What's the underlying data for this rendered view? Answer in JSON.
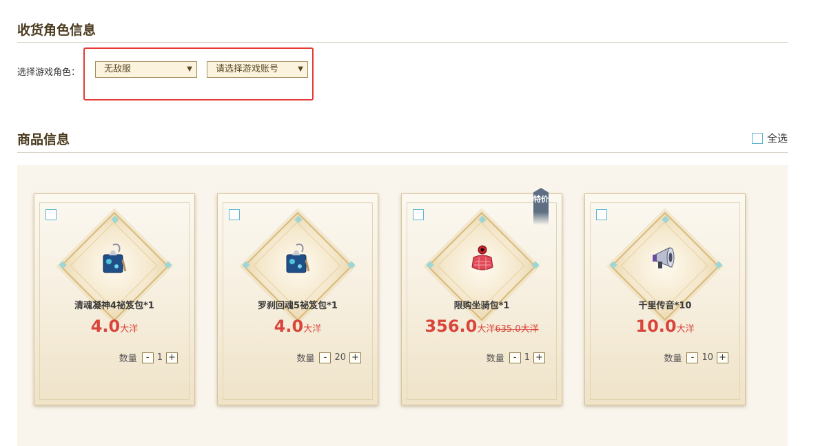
{
  "receiver": {
    "title": "收货角色信息",
    "label": "选择游戏角色：",
    "server_select": "无敌服",
    "account_select": "请选择游戏账号"
  },
  "goods": {
    "title": "商品信息",
    "select_all": "全选",
    "qty_label": "数量",
    "minus": "-",
    "plus": "+",
    "items": [
      {
        "name": "清魂凝神4祕笈包*1",
        "price": "4.0",
        "unit": "大洋",
        "old_price": "",
        "qty": "1",
        "icon": "blue-gift-bag-icon"
      },
      {
        "name": "罗刹回魂5祕笈包*1",
        "price": "4.0",
        "unit": "大洋",
        "old_price": "",
        "qty": "20",
        "icon": "blue-gift-bag-icon"
      },
      {
        "name": "限购坐骑包*1",
        "price": "356.0",
        "unit": "大洋",
        "old_price": "635.0大洋",
        "qty": "1",
        "icon": "red-pouch-icon",
        "badge": "特价"
      },
      {
        "name": "千里传音*10",
        "price": "10.0",
        "unit": "大洋",
        "old_price": "",
        "qty": "10",
        "icon": "megaphone-icon"
      }
    ]
  },
  "colors": {
    "accent_red": "#d9443b",
    "highlight_box": "#e53935",
    "checkbox_border": "#5eb3d6"
  }
}
